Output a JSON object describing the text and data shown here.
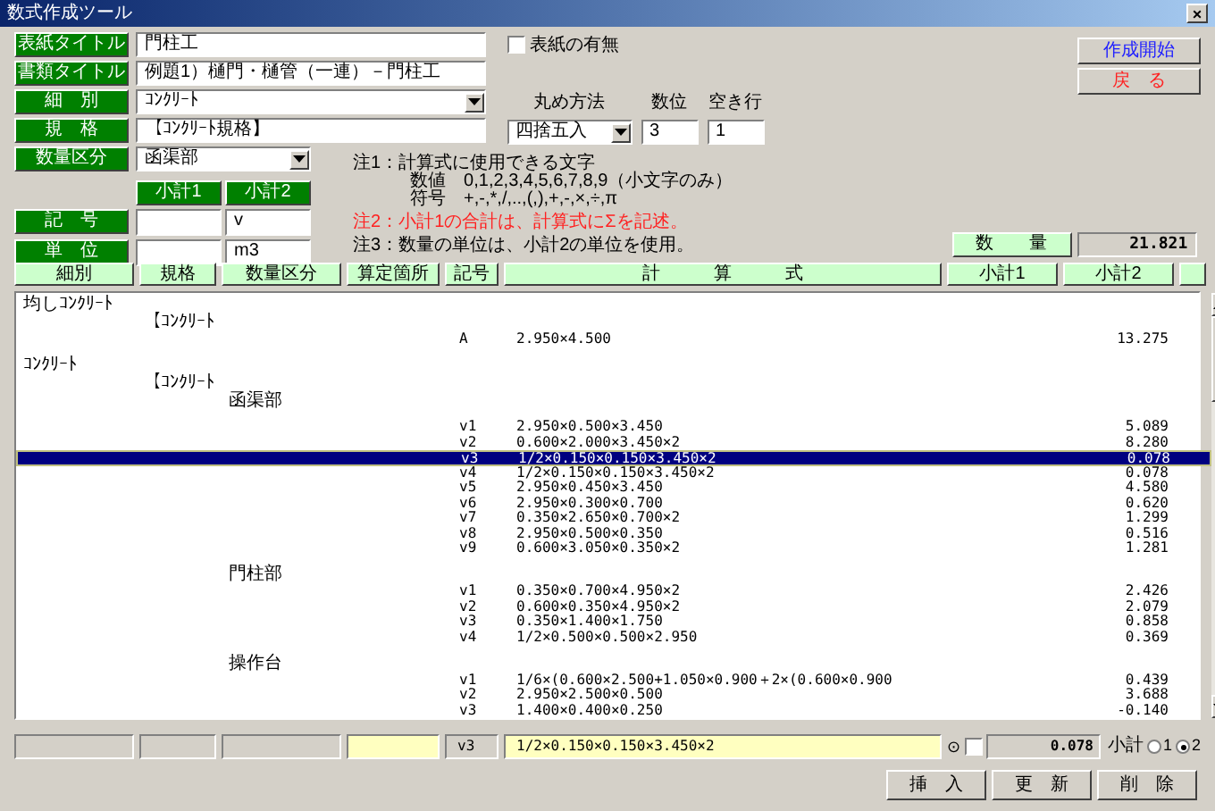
{
  "window": {
    "title": "数式作成ツール",
    "close": "×"
  },
  "form": {
    "fields": [
      {
        "label": "表紙タイトル",
        "value": "門柱工",
        "kind": "text"
      },
      {
        "label": "書類タイトル",
        "value": "例題1）樋門・樋管（一連）－門柱工",
        "kind": "text"
      },
      {
        "label": "細　別",
        "value": "ｺﾝｸﾘｰﾄ",
        "kind": "combo"
      },
      {
        "label": "規　格",
        "value": "【ｺﾝｸﾘｰﾄ規格】",
        "kind": "text"
      },
      {
        "label": "数量区分",
        "value": "函渠部",
        "kind": "combo"
      }
    ],
    "cover_checkbox": {
      "label": "表紙の有無",
      "checked": false
    },
    "rounding": {
      "label": "丸め方法",
      "value": "四捨五入"
    },
    "digits": {
      "label": "数位",
      "value": "3"
    },
    "blank_lines": {
      "label": "空き行",
      "value": "1"
    },
    "buttons": [
      {
        "label": "作成開始",
        "kind": "start"
      },
      {
        "label": "戻　る",
        "kind": "back"
      }
    ],
    "subtotal_headers": [
      "小計1",
      "小計2"
    ],
    "subtotal_rows": [
      {
        "label": "記　号",
        "subtotal2": "v"
      },
      {
        "label": "単　位",
        "subtotal2": "m3"
      }
    ],
    "notes": [
      {
        "text": "注1：計算式に使用できる文字",
        "kind": "normal"
      },
      {
        "text": "数値　0,1,2,3,4,5,6,7,8,9（小文字のみ）",
        "kind": "indent"
      },
      {
        "text": "符号　+,-,*,/,..,(,),+,-,×,÷,π",
        "kind": "indent"
      },
      {
        "text": "注2：小計1の合計は、計算式にΣを記述。",
        "kind": "warning"
      },
      {
        "text": "注3：数量の単位は、小計2の単位を使用。",
        "kind": "normal"
      }
    ],
    "quantity": {
      "label": "数　　量",
      "value": "21.821"
    }
  },
  "table": {
    "columns": [
      "細別",
      "規格",
      "数量区分",
      "算定箇所",
      "記号",
      "計　　　算　　　式",
      "小計1",
      "小計2"
    ],
    "rows": [
      {
        "kind": "detail",
        "text": "均しｺﾝｸﾘｰﾄ",
        "selected": false
      },
      {
        "kind": "spec",
        "text": "【ｺﾝｸﾘｰﾄ",
        "selected": false
      },
      {
        "kind": "line",
        "symbol": "A",
        "formula": "2.950×4.500",
        "subtotal2": "13.275",
        "selected": false
      },
      {
        "kind": "blank"
      },
      {
        "kind": "detail",
        "text": "ｺﾝｸﾘｰﾄ",
        "selected": false
      },
      {
        "kind": "spec",
        "text": "【ｺﾝｸﾘｰﾄ",
        "selected": false
      },
      {
        "kind": "division",
        "text": "函渠部",
        "selected": false
      },
      {
        "kind": "blank"
      },
      {
        "kind": "line",
        "symbol": "v1",
        "formula": "2.950×0.500×3.450",
        "subtotal2": "5.089",
        "selected": false
      },
      {
        "kind": "line",
        "symbol": "v2",
        "formula": "0.600×2.000×3.450×2",
        "subtotal2": "8.280",
        "selected": false
      },
      {
        "kind": "line",
        "symbol": "v3",
        "formula": "1/2×0.150×0.150×3.450×2",
        "subtotal2": "0.078",
        "selected": true
      },
      {
        "kind": "line",
        "symbol": "v4",
        "formula": "1/2×0.150×0.150×3.450×2",
        "subtotal2": "0.078",
        "selected": false
      },
      {
        "kind": "line",
        "symbol": "v5",
        "formula": "2.950×0.450×3.450",
        "subtotal2": "4.580",
        "selected": false
      },
      {
        "kind": "line",
        "symbol": "v6",
        "formula": "2.950×0.300×0.700",
        "subtotal2": "0.620",
        "selected": false
      },
      {
        "kind": "line",
        "symbol": "v7",
        "formula": "0.350×2.650×0.700×2",
        "subtotal2": "1.299",
        "selected": false
      },
      {
        "kind": "line",
        "symbol": "v8",
        "formula": "2.950×0.500×0.350",
        "subtotal2": "0.516",
        "selected": false
      },
      {
        "kind": "line",
        "symbol": "v9",
        "formula": "0.600×3.050×0.350×2",
        "subtotal2": "1.281",
        "selected": false
      },
      {
        "kind": "blank"
      },
      {
        "kind": "division",
        "text": "門柱部",
        "selected": false
      },
      {
        "kind": "line",
        "symbol": "v1",
        "formula": "0.350×0.700×4.950×2",
        "subtotal2": "2.426",
        "selected": false
      },
      {
        "kind": "line",
        "symbol": "v2",
        "formula": "0.600×0.350×4.950×2",
        "subtotal2": "2.079",
        "selected": false
      },
      {
        "kind": "line",
        "symbol": "v3",
        "formula": "0.350×1.400×1.750",
        "subtotal2": "0.858",
        "selected": false
      },
      {
        "kind": "line",
        "symbol": "v4",
        "formula": "1/2×0.500×0.500×2.950",
        "subtotal2": "0.369",
        "selected": false
      },
      {
        "kind": "blank"
      },
      {
        "kind": "division",
        "text": "操作台",
        "selected": false
      },
      {
        "kind": "line",
        "symbol": "v1",
        "formula": "1/6×(0.600×2.500+1.050×0.900＋2×(0.600×0.900",
        "subtotal2": "0.439",
        "selected": false
      },
      {
        "kind": "line",
        "symbol": "v2",
        "formula": "2.950×2.500×0.500",
        "subtotal2": "3.688",
        "selected": false
      },
      {
        "kind": "line",
        "symbol": "v3",
        "formula": "1.400×0.400×0.250",
        "subtotal2": "-0.140",
        "selected": false
      }
    ]
  },
  "editor": {
    "symbol": "v3",
    "formula": "1/2×0.150×0.150×3.450×2",
    "sigma": "⊙",
    "sigma_checked": false,
    "result": "0.078",
    "subtotal_label": "小計",
    "subtotal_options": [
      {
        "label": "1",
        "selected": false
      },
      {
        "label": "2",
        "selected": true
      }
    ],
    "buttons": [
      "挿　入",
      "更　新",
      "削　除"
    ]
  }
}
